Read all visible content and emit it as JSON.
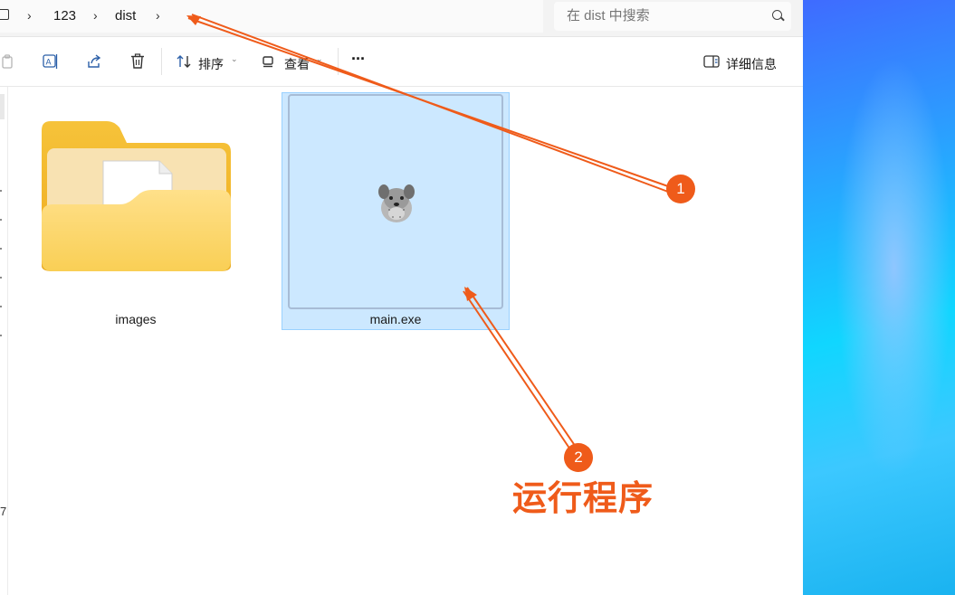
{
  "breadcrumb": {
    "items": [
      "123",
      "dist"
    ],
    "chevrons": [
      "›",
      "›",
      "›"
    ]
  },
  "search": {
    "placeholder": "在 dist 中搜索"
  },
  "toolbar": {
    "sort_label": "排序",
    "view_label": "查看",
    "more_label": "···",
    "details_label": "详细信息"
  },
  "files": [
    {
      "name": "images",
      "kind": "folder"
    },
    {
      "name": "main.exe",
      "kind": "executable",
      "selected": true
    }
  ],
  "nav_fragment": "7.",
  "annotation": {
    "text": "运行程序",
    "badge1": "1",
    "badge2": "2",
    "color": "#ef5b1a"
  },
  "colors": {
    "selection_fill": "#cce8ff",
    "selection_border": "#99d1ff",
    "accent": "#2b5fa8"
  }
}
